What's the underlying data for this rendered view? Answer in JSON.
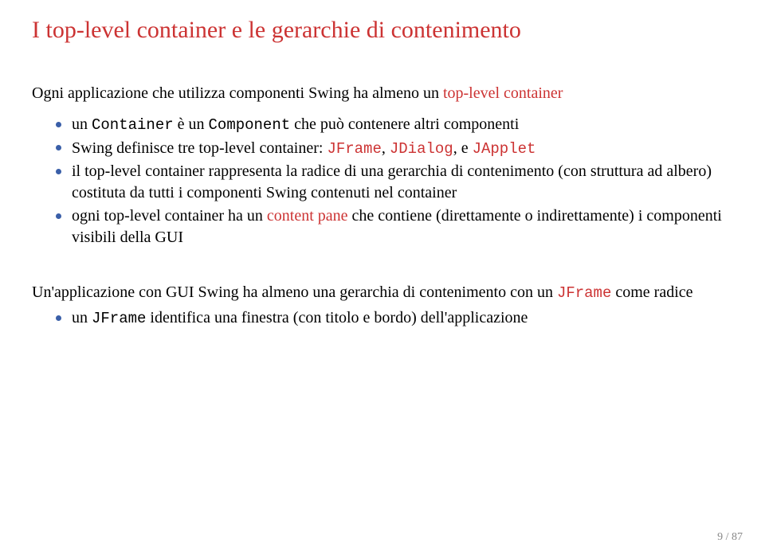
{
  "title": "I top-level container e le gerarchie di contenimento",
  "intro": {
    "pre": "Ogni applicazione che utilizza componenti Swing ha almeno un ",
    "accent": "top-level container",
    "post": ""
  },
  "bullets": [
    {
      "parts": [
        {
          "t": "text",
          "v": "un "
        },
        {
          "t": "mono",
          "v": "Container"
        },
        {
          "t": "text",
          "v": " è un "
        },
        {
          "t": "mono",
          "v": "Component"
        },
        {
          "t": "text",
          "v": " che può contenere altri componenti"
        }
      ]
    },
    {
      "parts": [
        {
          "t": "text",
          "v": "Swing definisce tre top-level container: "
        },
        {
          "t": "monored",
          "v": "JFrame"
        },
        {
          "t": "text",
          "v": ", "
        },
        {
          "t": "monored",
          "v": "JDialog"
        },
        {
          "t": "text",
          "v": ", e "
        },
        {
          "t": "monored",
          "v": "JApplet"
        }
      ]
    },
    {
      "parts": [
        {
          "t": "text",
          "v": "il top-level container rappresenta la radice di una gerarchia di contenimento (con struttura ad albero) costituta da tutti i componenti Swing contenuti nel container"
        }
      ]
    },
    {
      "parts": [
        {
          "t": "text",
          "v": "ogni top-level container ha un "
        },
        {
          "t": "accent",
          "v": "content pane"
        },
        {
          "t": "text",
          "v": " che contiene (direttamente o indirettamente) i componenti visibili della GUI"
        }
      ]
    }
  ],
  "section2_intro": {
    "parts": [
      {
        "t": "text",
        "v": "Un'applicazione con GUI Swing ha almeno una gerarchia di contenimento con un "
      },
      {
        "t": "monored",
        "v": "JFrame"
      },
      {
        "t": "text",
        "v": " come radice"
      }
    ]
  },
  "section2_bullets": [
    {
      "parts": [
        {
          "t": "text",
          "v": "un "
        },
        {
          "t": "mono",
          "v": "JFrame"
        },
        {
          "t": "text",
          "v": " identifica una finestra (con titolo e bordo) dell'applicazione"
        }
      ]
    }
  ],
  "page_number": "9 / 87"
}
